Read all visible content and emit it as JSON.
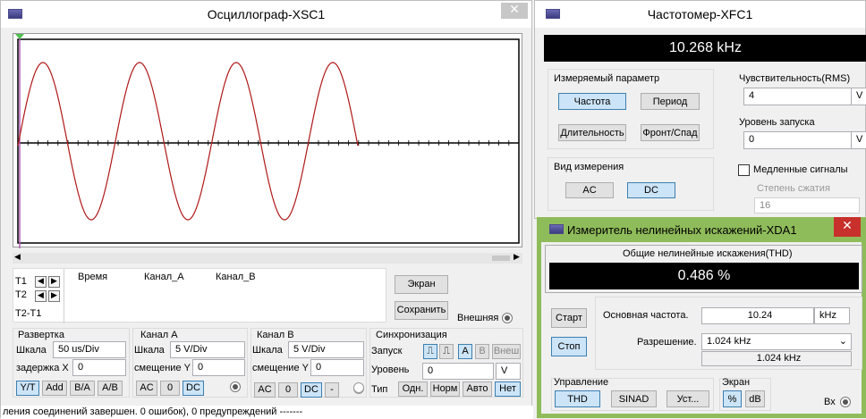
{
  "osc": {
    "title": "Осциллограф-XSC1",
    "close": "✕",
    "cursors": {
      "t1": "T1",
      "t2": "T2",
      "diff": "T2-T1"
    },
    "columns": {
      "time": "Время",
      "ch_a": "Канал_A",
      "ch_b": "Канал_B"
    },
    "screen_btn": "Экран",
    "save_btn": "Сохранить",
    "external": "Внешняя",
    "timebase": {
      "title": "Развертка",
      "scale_label": "Шкала",
      "scale": "50 us/Div",
      "delay_label": "задержка X",
      "delay": "0",
      "yt": "Y/T",
      "add": "Add",
      "ba": "B/A",
      "ab": "A/B"
    },
    "channel_a": {
      "title": "Канал A",
      "scale_label": "Шкала",
      "scale": "5  V/Div",
      "offset_label": "смещение Y",
      "offset": "0",
      "ac": "AC",
      "zero": "0",
      "dc": "DC"
    },
    "channel_b": {
      "title": "Канал B",
      "scale_label": "Шкала",
      "scale": "5  V/Div",
      "offset_label": "смещение Y",
      "offset": "0",
      "ac": "AC",
      "zero": "0",
      "dc": "DC",
      "minus": "-"
    },
    "trigger": {
      "title": "Синхронизация",
      "start_label": "Запуск",
      "a": "A",
      "b": "B",
      "ext": "Внеш",
      "level_label": "Уровень",
      "level": "0",
      "unit": "V",
      "type_label": "Тип",
      "single": "Одн.",
      "normal": "Норм",
      "auto": "Авто",
      "none": "Нет"
    }
  },
  "status_bar": "ления соединений завершен. 0 ошибок), 0 предупреждений -------",
  "freq": {
    "title": "Частотомер-XFC1",
    "reading": "10.268 kHz",
    "measured_title": "Измеряемый параметр",
    "frequency": "Частота",
    "period": "Период",
    "duration": "Длительность",
    "edge": "Фронт/Спад",
    "sens_title": "Чувствительность(RMS)",
    "sens_value": "4",
    "sens_unit": "V",
    "trig_title": "Уровень запуска",
    "trig_value": "0",
    "trig_unit": "V",
    "mode_title": "Вид измерения",
    "ac": "AC",
    "dc": "DC",
    "slow": "Медленные сигналы",
    "compress_label": "Степень сжатия",
    "compress_value": "16"
  },
  "dist": {
    "title": "Измеритель нелинейных искажений-XDA1",
    "close": "✕",
    "reading_title": "Общие нелинейные искажения(THD)",
    "reading": "0.486 %",
    "start": "Старт",
    "stop": "Стоп",
    "fund_label": "Основная частота.",
    "fund_value": "10.24",
    "fund_unit": "kHz",
    "res_label": "Разрешение.",
    "res_value": "1.024 kHz",
    "res_display": "1.024 kHz",
    "control_title": "Управление",
    "thd": "THD",
    "sinad": "SINAD",
    "settings": "Уст...",
    "screen_title": "Экран",
    "percent": "%",
    "db": "dB",
    "input": "Вх"
  },
  "colors": {
    "trace": "#b01818",
    "screen": "#000000",
    "accent": "#3c7fb1",
    "green_frame": "#8fbc5a"
  }
}
